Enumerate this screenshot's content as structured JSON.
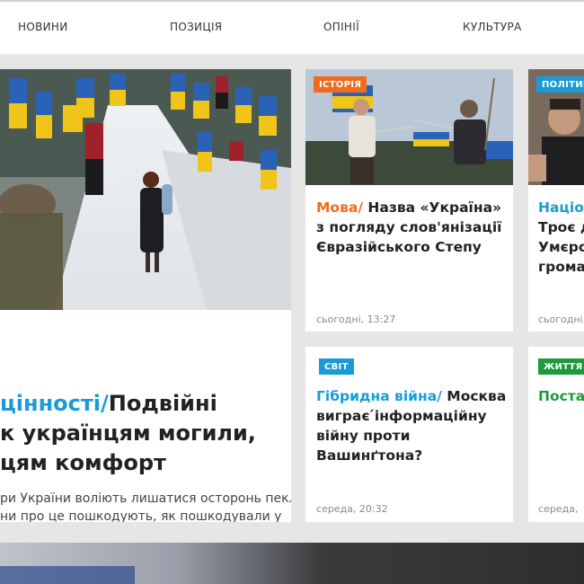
{
  "nav": {
    "items": [
      {
        "label": "НОВИНИ"
      },
      {
        "label": "ПОЗИЦІЯ"
      },
      {
        "label": "ОПІНІЇ"
      },
      {
        "label": "КУЛЬТУРА"
      }
    ]
  },
  "main_story": {
    "rubric": "цінності/",
    "headline_line1": "Подвійні",
    "headline_line2": "к українцям могили,",
    "headline_line3": "цям комфорт",
    "lead_line1": "ри України воліють лишатися осторонь пекла",
    "lead_line2": "ни про це пошкодують, як пошкодували у"
  },
  "cards": [
    {
      "tag": "ІСТОРІЯ",
      "tag_color": "#f26b1d",
      "rubric": "Мова/",
      "rubric_color": "#f26b1d",
      "title_line1": "Назва «Україна»",
      "title_line2": "з погляду слов'янізації",
      "title_line3": "Євразійського Степу",
      "time": "сьогодні, 13:27"
    },
    {
      "tag": "ПОЛІТИКА",
      "tag_color": "#1a9bd7",
      "rubric": "Націо",
      "rubric_color": "#1a9bd7",
      "title_line1": "Троє д",
      "title_line2": "Умєро",
      "title_line3": "грома",
      "time": "сьогодні,"
    },
    {
      "tag": "СВІТ",
      "tag_color": "#1a9bd7",
      "rubric": "Гібридна війна/",
      "rubric_color": "#1a9bd7",
      "title_line1": "Москва",
      "title_line2": "виграє ́інформаційну",
      "title_line3": "війну проти",
      "title_line4": "Вашинґтона?",
      "time": "середа, 20:32"
    },
    {
      "tag": "ЖИТТЯ",
      "tag_color": "#1e9a3c",
      "rubric": "Постат",
      "rubric_color": "#1e9a3c",
      "time": "середа,"
    }
  ],
  "colors": {
    "accent_blue": "#1a9bd7",
    "accent_orange": "#f26b1d",
    "accent_green": "#1e9a3c"
  }
}
